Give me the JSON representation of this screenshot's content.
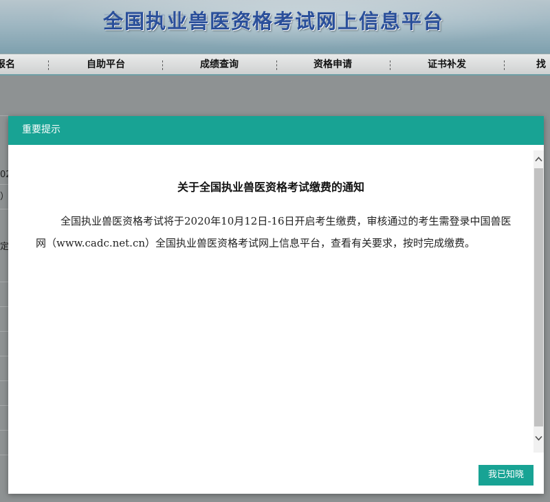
{
  "site": {
    "title": "全国执业兽医资格考试网上信息平台"
  },
  "nav": {
    "items": [
      {
        "label": "报名"
      },
      {
        "label": "自助平台"
      },
      {
        "label": "成绩查询"
      },
      {
        "label": "资格申请"
      },
      {
        "label": "证书补发"
      },
      {
        "label": "找"
      }
    ]
  },
  "background_fragments": [
    "02",
    "）",
    "定"
  ],
  "modal": {
    "title": "重要提示",
    "notice_title": "关于全国执业兽医资格考试缴费的通知",
    "notice_body": "全国执业兽医资格考试将于2020年10月12日-16日开启考生缴费，审核通过的考生需登录中国兽医网（www.cadc.net.cn）全国执业兽医资格考试网上信息平台，查看有关要求，按时完成缴费。",
    "ack_button": "我已知晓"
  },
  "colors": {
    "accent": "#18a394",
    "title_blue": "#2a4f9a"
  },
  "icons": {
    "scroll_up": "chevron-up-icon",
    "scroll_down": "chevron-down-icon"
  }
}
